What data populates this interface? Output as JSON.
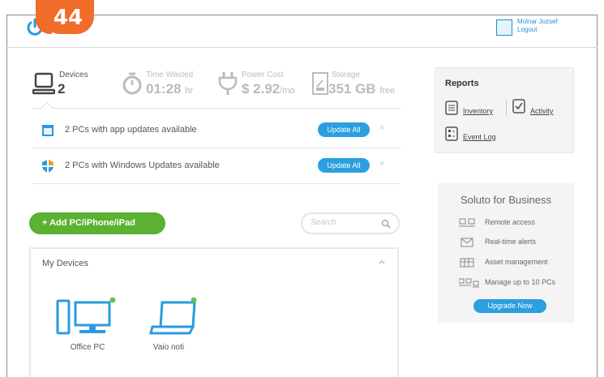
{
  "badge": {
    "number": "44"
  },
  "user": {
    "name": "Molnar Jozsef",
    "logout": "Logout"
  },
  "stats": {
    "devices": {
      "label": "Devices",
      "value": "2"
    },
    "time_wasted": {
      "label": "Time Wasted",
      "value": "01:28",
      "unit": "hr"
    },
    "power_cost": {
      "label": "Power Cost",
      "value": "$ 2.92",
      "unit": "/mo"
    },
    "storage": {
      "label": "Storage",
      "value": "351 GB",
      "unit": "free"
    }
  },
  "notifications": [
    {
      "text": "2 PCs with app updates available",
      "button": "Update All",
      "close": "×"
    },
    {
      "text": "2 PCs with Windows Updates available",
      "button": "Update All",
      "close": "×"
    }
  ],
  "add_button": {
    "label": "+ Add PC/iPhone/iPad"
  },
  "search": {
    "placeholder": "Search"
  },
  "my_devices": {
    "title": "My Devices",
    "devices": [
      {
        "name": "Office PC",
        "status_color": "#6cc04a"
      },
      {
        "name": "Vaio noti",
        "status_color": "#6cc04a"
      }
    ]
  },
  "reports": {
    "title": "Reports",
    "links": {
      "inventory": "Inventory",
      "activity": "Activity",
      "event_log": "Event Log"
    }
  },
  "business": {
    "title": "Soluto for Business",
    "features": [
      {
        "icon": "remote-access-icon",
        "label": "Remote access"
      },
      {
        "icon": "envelope-icon",
        "label": "Real-time alerts"
      },
      {
        "icon": "table-icon",
        "label": "Asset management"
      },
      {
        "icon": "multi-pc-icon",
        "label": "Manage up to 10 PCs"
      }
    ],
    "upgrade": "Upgrade Now"
  },
  "colors": {
    "accent_blue": "#2b9fe0",
    "green": "#5ab132",
    "badge_orange": "#f06c28"
  }
}
